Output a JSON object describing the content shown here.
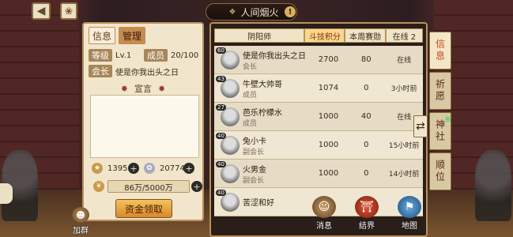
{
  "header": {
    "title": "人间烟火",
    "back_icon": "back-arrow-icon",
    "badge_icon": "guild-emblem-icon"
  },
  "left": {
    "tab_info": "信息",
    "tab_manage": "管理",
    "level_label": "等级",
    "level_value": "Lv.1",
    "members_label": "成员",
    "members_value": "20/100",
    "leader_label": "会长",
    "leader_value": "使是你我出头之日",
    "motto_title": "宣言",
    "res1_value": "1395",
    "res2_value": "20774",
    "fund_value": "86万/5000万",
    "claim_button": "资金领取"
  },
  "table": {
    "headers": [
      "阴阳师",
      "斗技积分",
      "本周赛勋",
      "在线 2"
    ],
    "rows": [
      {
        "level": "60",
        "name": "使是你我出头之日",
        "role": "会长",
        "score": "2700",
        "week": "80",
        "status": "在线"
      },
      {
        "level": "43",
        "name": "牛壁大帅哥",
        "role": "成员",
        "score": "1074",
        "week": "0",
        "status": "3小时前"
      },
      {
        "level": "27",
        "name": "芭乐柠檬水",
        "role": "成员",
        "score": "1000",
        "week": "40",
        "status": "在线"
      },
      {
        "level": "40",
        "name": "兔小卡",
        "role": "副会长",
        "score": "1000",
        "week": "0",
        "status": "15小时前"
      },
      {
        "level": "40",
        "name": "火男金",
        "role": "副会长",
        "score": "1000",
        "week": "0",
        "status": "14小时前"
      },
      {
        "level": "40",
        "name": "苦涩和好",
        "role": "",
        "score": "",
        "week": "",
        "status": ""
      }
    ]
  },
  "side_tabs": [
    "信息",
    "祈愿",
    "神社",
    "顺位"
  ],
  "side_new": "新",
  "bottom": {
    "invite": "加群",
    "messages": "消息",
    "barrier": "结界",
    "map": "地图"
  },
  "colors": {
    "panel_bg": "#f1e6cc",
    "accent": "#c14a1a",
    "button": "#f3c35a"
  }
}
